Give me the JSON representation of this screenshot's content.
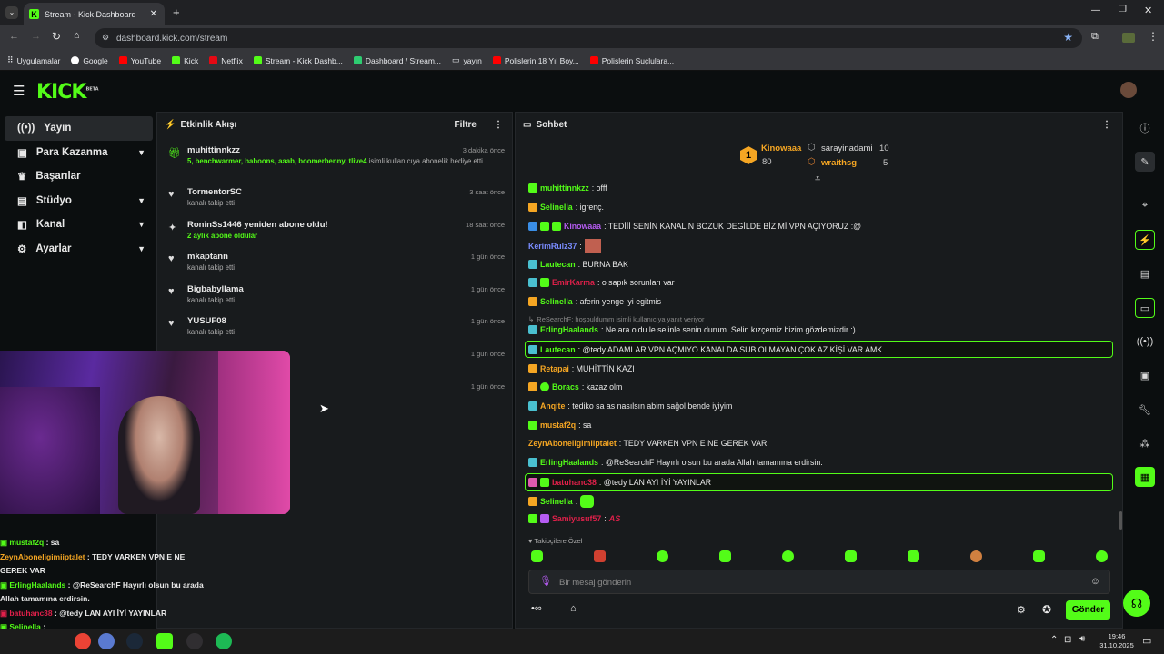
{
  "browser": {
    "tab_title": "Stream - Kick Dashboard",
    "url": "dashboard.kick.com/stream",
    "bookmarks": [
      "Uygulamalar",
      "Google",
      "YouTube",
      "Kick",
      "Netflix",
      "Stream - Kick Dashb...",
      "Dashboard / Stream...",
      "yayın",
      "Polislerin 18 Yıl Boy...",
      "Polislerin Suçlulara..."
    ]
  },
  "brand": {
    "logo": "KICK",
    "beta": "BETA",
    "accent": "#53fc18"
  },
  "sidebar": {
    "items": [
      {
        "label": "Yayın",
        "icon": "broadcast-icon"
      },
      {
        "label": "Para Kazanma",
        "icon": "money-icon"
      },
      {
        "label": "Başarılar",
        "icon": "trophy-icon"
      },
      {
        "label": "Stüdyo",
        "icon": "studio-icon"
      },
      {
        "label": "Kanal",
        "icon": "channel-icon"
      },
      {
        "label": "Ayarlar",
        "icon": "gear-icon"
      }
    ]
  },
  "activity": {
    "title": "Etkinlik Akışı",
    "filter": "Filtre",
    "events": [
      {
        "name": "muhittinnkzz",
        "detail": "5, benchwarmer, baboons, aaab, boomerbenny, tlive4",
        "detail2": " isimli kullanıcıya abonelik hediye etti.",
        "time": "3 dakika önce"
      },
      {
        "name": "TormentorSC",
        "detail": "kanalı takip etti",
        "time": "3 saat önce"
      },
      {
        "name": "RoninSs1446 yeniden abone oldu!",
        "detail": "2 aylık abone oldular",
        "time": "18 saat önce"
      },
      {
        "name": "mkaptann",
        "detail": "kanalı takip etti",
        "time": "1 gün önce"
      },
      {
        "name": "Bigbabyllama",
        "detail": "kanalı takip etti",
        "time": "1 gün önce"
      },
      {
        "name": "YUSUF08",
        "detail": "kanalı takip etti",
        "time": "1 gün önce"
      },
      {
        "name": "",
        "detail": "",
        "time": "1 gün önce"
      },
      {
        "name": "",
        "detail": "",
        "time": "1 gün önce"
      }
    ]
  },
  "chat": {
    "title": "Sohbet",
    "leaders": [
      {
        "rank": "1",
        "name": "Kinowaaa",
        "value": "80"
      },
      {
        "name": "sarayinadami",
        "value": "10"
      },
      {
        "name": "wraithsg",
        "value": "5"
      }
    ],
    "messages": [
      {
        "user": "muhittinnkzz",
        "color": "#53fc18",
        "text": ": offf"
      },
      {
        "user": "Selinella",
        "color": "#53fc18",
        "text": ": igrenç."
      },
      {
        "user": "Kinowaaa",
        "color": "#b65cf3",
        "text": ": TEDİİİ SENİN KANALIN BOZUK DEGİLDE BİZ Mİ VPN AÇIYORUZ :@"
      },
      {
        "user": "KerimRulz37",
        "color": "#7a8cff",
        "text": ":"
      },
      {
        "user": "Lautecan",
        "color": "#53fc18",
        "text": ": BURNA BAK"
      },
      {
        "user": "EmirKarma",
        "color": "#e0204a",
        "text": ": o sapık sorunları var"
      },
      {
        "user": "Selinella",
        "color": "#53fc18",
        "text": ": aferin yenge iyi egitmis"
      },
      {
        "user": "ErlingHaalands",
        "color": "#53fc18",
        "text": ": Ne ara oldu le selinle senin durum. Selin kızçemiz bizim gözdemizdir :)",
        "reply": "ReSearchF: hoşbuldumm isimli kullanıcıya yanıt veriyor"
      },
      {
        "user": "Lautecan",
        "color": "#53fc18",
        "text": ": @tedy ADAMLAR VPN AÇMIYO KANALDA SUB OLMAYAN ÇOK AZ KİŞİ VAR AMK"
      },
      {
        "user": "Retapai",
        "color": "#f5a623",
        "text": ": MUHİTTİN KAZI"
      },
      {
        "user": "Boracs",
        "color": "#53fc18",
        "text": ": kazaz olm"
      },
      {
        "user": "Anqite",
        "color": "#f5a623",
        "text": ": tediko sa as nasılsın abim sağol bende iyiyim"
      },
      {
        "user": "mustaf2q",
        "color": "#f5a623",
        "text": ": sa"
      },
      {
        "user": "ZeynAboneligimiiptalet",
        "color": "#f5a623",
        "text": ": TEDY VARKEN VPN E NE GEREK VAR"
      },
      {
        "user": "ErlingHaalands",
        "color": "#53fc18",
        "text": ": @ReSearchF Hayırlı olsun bu arada Allah tamamına erdirsin."
      },
      {
        "user": "batuhanc38",
        "color": "#e0204a",
        "text": ": @tedy LAN AYI İYİ YAYINLAR"
      },
      {
        "user": "Selinella",
        "color": "#53fc18",
        "text": ":"
      },
      {
        "user": "Samiyusuf57",
        "color": "#e0204a",
        "text": ":"
      }
    ],
    "emote_tab": "Takipçilere Özel",
    "input_placeholder": "Bir mesaj gönderin",
    "send": "Gönder"
  },
  "overlay_chat": [
    {
      "user": "mustaf2q",
      "color": "#53fc18",
      "text": " : sa"
    },
    {
      "user": "ZeynAboneligimiiptalet",
      "color": "#f5a623",
      "text": " : TEDY VARKEN VPN E NE GEREK VAR"
    },
    {
      "user": "ErlingHaalands",
      "color": "#53fc18",
      "text": " : @ReSearchF Hayırlı olsun bu arada Allah tamamına erdirsin."
    },
    {
      "user": "batuhanc38",
      "color": "#e0204a",
      "text": " : @tedy LAN AYI İYİ YAYINLAR"
    },
    {
      "user": "Selinella",
      "color": "#53fc18",
      "text": " :"
    }
  ],
  "taskbar": {
    "time": "19:46",
    "date": "31.10.2025"
  }
}
